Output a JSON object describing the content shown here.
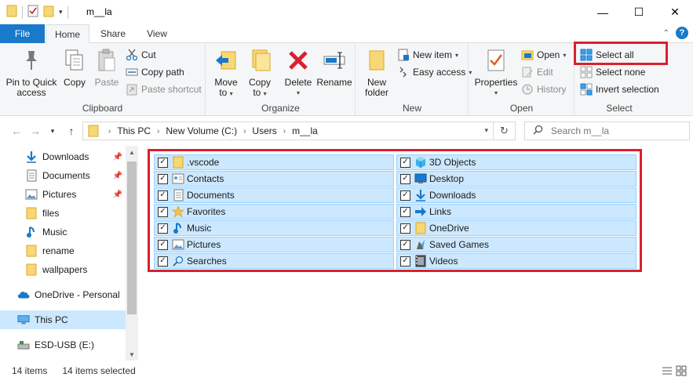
{
  "window": {
    "title": "m__la",
    "minimize_glyph": "—",
    "maximize_glyph": "☐",
    "close_glyph": "✕"
  },
  "tabs": {
    "file": "File",
    "home": "Home",
    "share": "Share",
    "view": "View",
    "help_glyph": "?"
  },
  "ribbon": {
    "clipboard": {
      "label": "Clipboard",
      "pin_line1": "Pin to Quick",
      "pin_line2": "access",
      "copy": "Copy",
      "paste": "Paste",
      "cut": "Cut",
      "copy_path": "Copy path",
      "paste_shortcut": "Paste shortcut"
    },
    "organize": {
      "label": "Organize",
      "move_line1": "Move",
      "move_line2": "to",
      "copy_line1": "Copy",
      "copy_line2": "to",
      "delete": "Delete",
      "rename": "Rename"
    },
    "new": {
      "label": "New",
      "new_folder_line1": "New",
      "new_folder_line2": "folder",
      "new_item": "New item",
      "easy_access": "Easy access"
    },
    "open": {
      "label": "Open",
      "properties": "Properties",
      "open": "Open",
      "edit": "Edit",
      "history": "History"
    },
    "select": {
      "label": "Select",
      "select_all": "Select all",
      "select_none": "Select none",
      "invert_selection": "Invert selection"
    }
  },
  "address": {
    "crumbs": [
      "This PC",
      "New Volume (C:)",
      "Users",
      "m__la"
    ],
    "search_placeholder": "Search m__la"
  },
  "nav_pane": {
    "items": [
      {
        "label": "Downloads",
        "icon": "download-icon",
        "pinned": true
      },
      {
        "label": "Documents",
        "icon": "documents-icon",
        "pinned": true
      },
      {
        "label": "Pictures",
        "icon": "pictures-icon",
        "pinned": true
      },
      {
        "label": "files",
        "icon": "folder-icon",
        "pinned": false
      },
      {
        "label": "Music",
        "icon": "music-icon",
        "pinned": false
      },
      {
        "label": "rename",
        "icon": "folder-icon",
        "pinned": false
      },
      {
        "label": "wallpapers",
        "icon": "folder-icon",
        "pinned": false
      },
      {
        "label": "OneDrive - Personal",
        "icon": "onedrive-icon",
        "pinned": false
      },
      {
        "label": "This PC",
        "icon": "this-pc-icon",
        "pinned": false,
        "selected": true
      },
      {
        "label": "ESD-USB (E:)",
        "icon": "usb-drive-icon",
        "pinned": false
      }
    ]
  },
  "files": {
    "left": [
      ".vscode",
      "Contacts",
      "Documents",
      "Favorites",
      "Music",
      "Pictures",
      "Searches"
    ],
    "right": [
      "3D Objects",
      "Desktop",
      "Downloads",
      "Links",
      "OneDrive",
      "Saved Games",
      "Videos"
    ]
  },
  "status": {
    "item_count": "14 items",
    "selected_count": "14 items selected"
  },
  "colors": {
    "accent": "#1979ca",
    "selection": "#cce8ff",
    "highlight": "#d9202f"
  }
}
